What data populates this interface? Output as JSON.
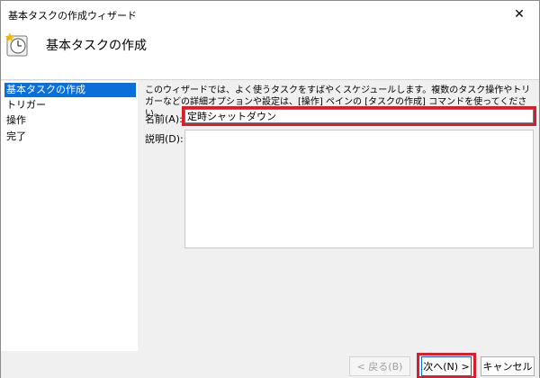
{
  "window": {
    "title": "基本タスクの作成ウィザード",
    "close_symbol": "✕"
  },
  "header": {
    "title": "基本タスクの作成"
  },
  "sidebar": {
    "items": [
      {
        "label": "基本タスクの作成",
        "active": true
      },
      {
        "label": "トリガー"
      },
      {
        "label": "操作"
      },
      {
        "label": "完了"
      }
    ]
  },
  "content": {
    "description": "このウィザードでは、よく使うタスクをすばやくスケジュールします。複数のタスク操作やトリガーなどの詳細オプションや設定は、[操作] ペインの [タスクの作成] コマンドを使ってください。",
    "name_label": "名前(A):",
    "name_value": "定時シャットダウン",
    "desc_label": "説明(D):",
    "desc_value": ""
  },
  "footer": {
    "back_label": "< 戻る(B)",
    "next_label": "次へ(N) >",
    "cancel_label": "キャンセル"
  },
  "colors": {
    "accent": "#0a6fd8",
    "highlight": "#d5202c"
  }
}
